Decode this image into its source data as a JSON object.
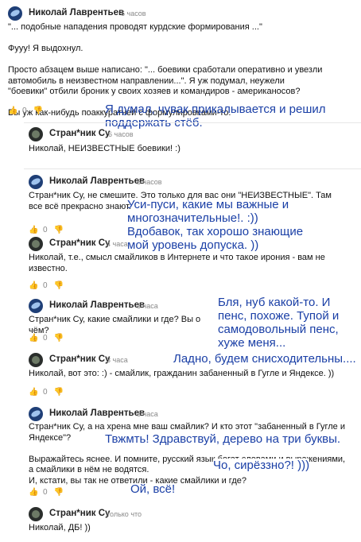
{
  "c1": {
    "author": "Николай Лаврентьев",
    "time": "6 часов",
    "text": "\"... подобные нападения проводят курдские формирования ...\"\n\nФууу! Я выдохнул.\n\nПросто абзацем выше написано: \"... боевики сработали оперативно и увезли автомобиль в неизвестном направлении...\". Я уж подумал, неужели \"боевики\" отбили броник у своих хозяев и командиров - американосов?\n\nВы уж как-нибудь поаккуратней с формулировками-то.",
    "likes": "0"
  },
  "c2": {
    "author": "Стран*ник Су",
    "time": "6 часов",
    "text": "Николай, НЕИЗВЕСТНЫЕ боевики! :)"
  },
  "c3": {
    "author": "Николай Лаврентьев",
    "time": "5 часов",
    "text": "Стран*ник Су, не смешите. Это только для вас они \"НЕИЗВЕСТНЫЕ\". Там все всё прекрасно знают.",
    "likes": "0"
  },
  "c4": {
    "author": "Стран*ник Су",
    "time": "4 часа",
    "text": "Николай, т.е., смысл смайликов в Интернете и что такое ирония - вам не известно.",
    "likes": "0"
  },
  "c5": {
    "author": "Николай Лаврентьев",
    "time": "3 часа",
    "text": "Стран*ник Су, какие смайлики и где? Вы о чём?",
    "likes": "0"
  },
  "c6": {
    "author": "Стран*ник Су",
    "time": "3 часа",
    "text": "Николай, вот это: :) - смайлик, гражданин забаненный в Гугле и Яндексе. ))",
    "likes": "0"
  },
  "c7": {
    "author": "Николай Лаврентьев",
    "time": "3 часа",
    "text": "Стран*ник Су, а на хрена мне ваш смайлик? И кто этот \"забаненный в Гугле и Яндексе\"?\n\nВыражайтесь яснее. И помните, русский язык богат словами и выражениями, а смайлики в нём не водятся.\nИ, кстати, вы так не ответили - какие смайлики и где?",
    "likes": "0"
  },
  "c8": {
    "author": "Стран*ник Су",
    "time": "только что",
    "text": "Николай, ДБ! ))"
  },
  "notes": {
    "n1": "Я думал, чувак прикалывается и решил\nподдержать стёб.",
    "n2": "Уси-пуси, какие мы важные и\nмногозначительные!. :))\nВдобавок, так хорошо знающие\nмой уровень допуска. ))",
    "n3": "Бля, нуб какой-то. И\nпенс, похоже. Тупой и\nсамодовольный пенс,\nхуже меня...",
    "n4": "Ладно, будем снисходительны....",
    "n5": "Твжмть! Здравствуй, дерево на три буквы.",
    "n6": "Чо, сирёззно?! )))",
    "n7": "Ой, всё!"
  },
  "icons": {
    "like": "thumb-up-icon",
    "dislike": "thumb-down-icon"
  },
  "colors": {
    "note": "#1a3fa6",
    "meta": "#888888"
  }
}
